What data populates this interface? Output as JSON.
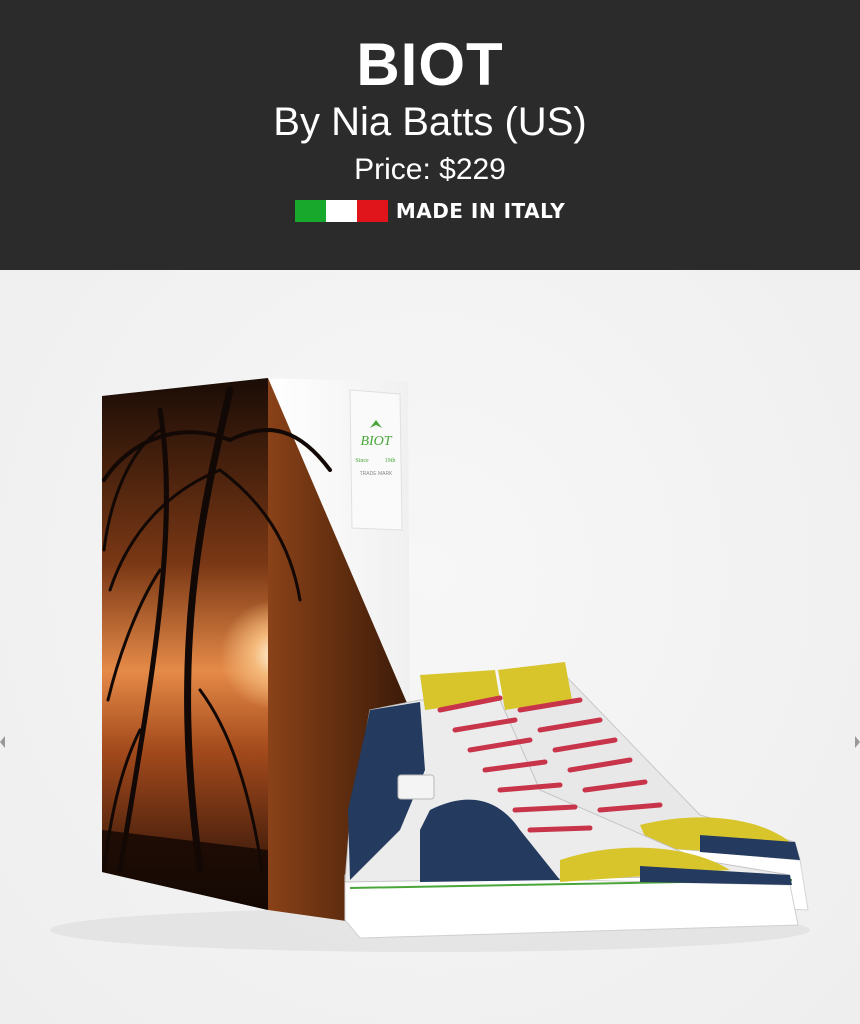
{
  "product": {
    "name": "BIOT",
    "byline": "By Nia Batts (US)",
    "price": "Price: $229",
    "origin_label": "MADE IN ITALY",
    "flag_colors": [
      "#18a82b",
      "#ffffff",
      "#e0141b"
    ]
  },
  "box_label": {
    "brand": "BIOT",
    "since": "Since",
    "year": "19th",
    "mark": "TRADE MARK"
  },
  "colors": {
    "header_bg": "#2b2b2b",
    "shoe_navy": "#243a5e",
    "shoe_yellow": "#d8c52c",
    "laces_red": "#c8354a",
    "leaf_green": "#4aa63a"
  },
  "icons": [
    "chevron-left-icon",
    "chevron-right-icon",
    "italy-flag-icon"
  ]
}
